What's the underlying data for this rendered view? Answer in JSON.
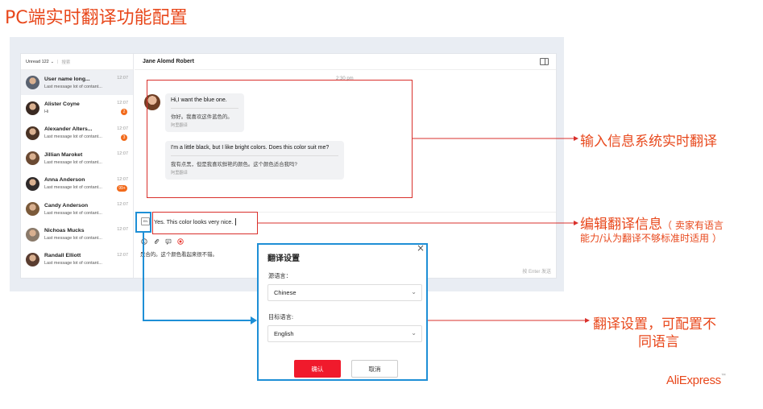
{
  "slide_title": "PC端实时翻译功能配置",
  "sidebar": {
    "filter_label": "Unread 122",
    "filter_ghost": "搜索",
    "items": [
      {
        "name": "User name long...",
        "msg": "Last message lot of contant...",
        "time": "12:07",
        "badge": "",
        "avatar": "#5a6270"
      },
      {
        "name": "Alister Coyne",
        "msg": "Hi",
        "time": "12:07",
        "badge": "2",
        "avatar": "#3a2a22"
      },
      {
        "name": "Alexander Alters...",
        "msg": "Last message lot of contant...",
        "time": "12:07",
        "badge": "3",
        "avatar": "#4a3325"
      },
      {
        "name": "Jillian Maroket",
        "msg": "Last message lot of contant...",
        "time": "12:07",
        "badge": "",
        "avatar": "#6b4a33"
      },
      {
        "name": "Anna Anderson",
        "msg": "Last message lot of contant...",
        "time": "12:07",
        "badge": "99+",
        "avatar": "#2f2a2a"
      },
      {
        "name": "Candy Anderson",
        "msg": "Last message lot of contant...",
        "time": "12:07",
        "badge": "",
        "avatar": "#7b5a3a"
      },
      {
        "name": "Nichoas Mucks",
        "msg": "Last message lot of contant...",
        "time": "12:07",
        "badge": "",
        "avatar": "#8a7a6a"
      },
      {
        "name": "Randall Elliott",
        "msg": "Last message lot of contant...",
        "time": "12:07",
        "badge": "",
        "avatar": "#5a3d30"
      }
    ]
  },
  "chat": {
    "contact_name": "Jane Alomd Robert",
    "timestamp": "2:30 pm",
    "messages": [
      {
        "text": "Hi,I want the blue one.",
        "translation": "你好。我喜欢这件蓝色的。",
        "note": "阿里翻译"
      },
      {
        "text": "I'm a little black, but I like bright colors. Does this color suit me?",
        "translation": "我有点黑，但是我喜欢鲜艳的颜色。这个颜色适合我吗?",
        "note": "阿里翻译"
      }
    ],
    "compose": {
      "lang_chip": "EN",
      "input_value": "Yes. This color looks very nice.",
      "draft": "是合的。这个颜色看起来很不错。",
      "send_hint": "按 Enter 发送"
    }
  },
  "dialog": {
    "title": "翻译设置",
    "close": "×",
    "source_label": "源语言：",
    "source_value": "Chinese",
    "target_label": "目标语言:",
    "target_value": "English",
    "confirm": "确认",
    "cancel": "取消"
  },
  "callouts": {
    "realtime": "输入信息系统实时翻译",
    "edit_main": "编辑翻译信息",
    "edit_note_1": "（ 卖家有语言",
    "edit_note_2": "能力/认为翻译不够标准时适用 ）",
    "settings_1": "翻译设置，可配置不",
    "settings_2": "同语言"
  },
  "brand": {
    "name": "AliExpress",
    "mark": "™"
  },
  "colors": {
    "accent": "#e8481c",
    "annotation_red": "#d9302c",
    "annotation_blue": "#1e8fd6",
    "confirm_red": "#f01a2c",
    "badge_orange": "#f26a1b"
  }
}
